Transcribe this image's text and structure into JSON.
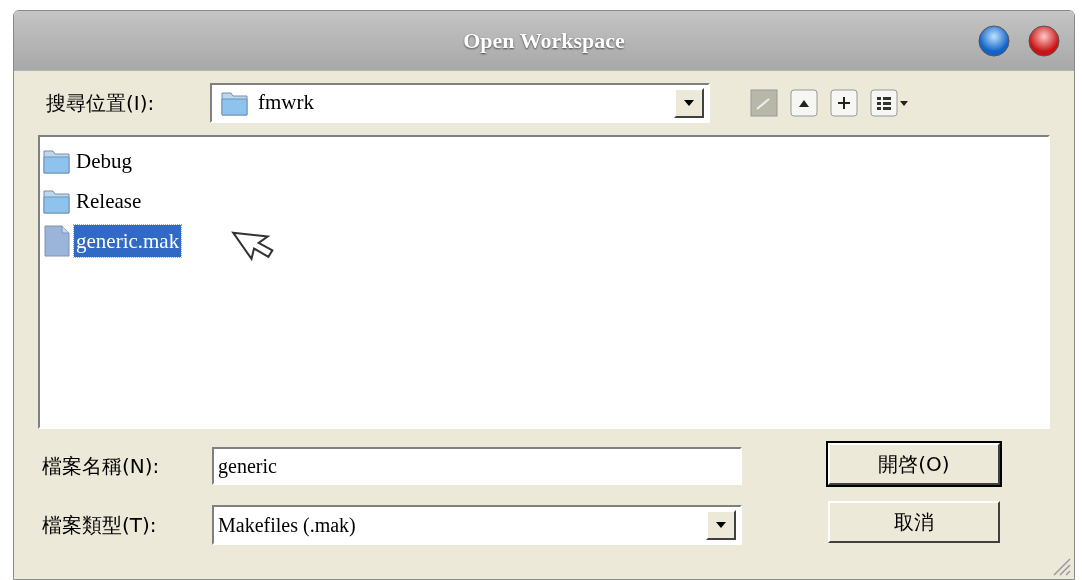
{
  "window": {
    "title": "Open Workspace"
  },
  "look_in": {
    "label": "搜尋位置(I):",
    "value": "fmwrk"
  },
  "files": [
    {
      "name": "Debug",
      "kind": "folder",
      "selected": false
    },
    {
      "name": "Release",
      "kind": "folder",
      "selected": false
    },
    {
      "name": "generic.mak",
      "kind": "file",
      "selected": true
    }
  ],
  "file_name": {
    "label": "檔案名稱(N):",
    "value": "generic"
  },
  "file_type": {
    "label": "檔案類型(T):",
    "value": "Makefiles (.mak)"
  },
  "buttons": [
    "開啓(O)",
    "取消"
  ]
}
